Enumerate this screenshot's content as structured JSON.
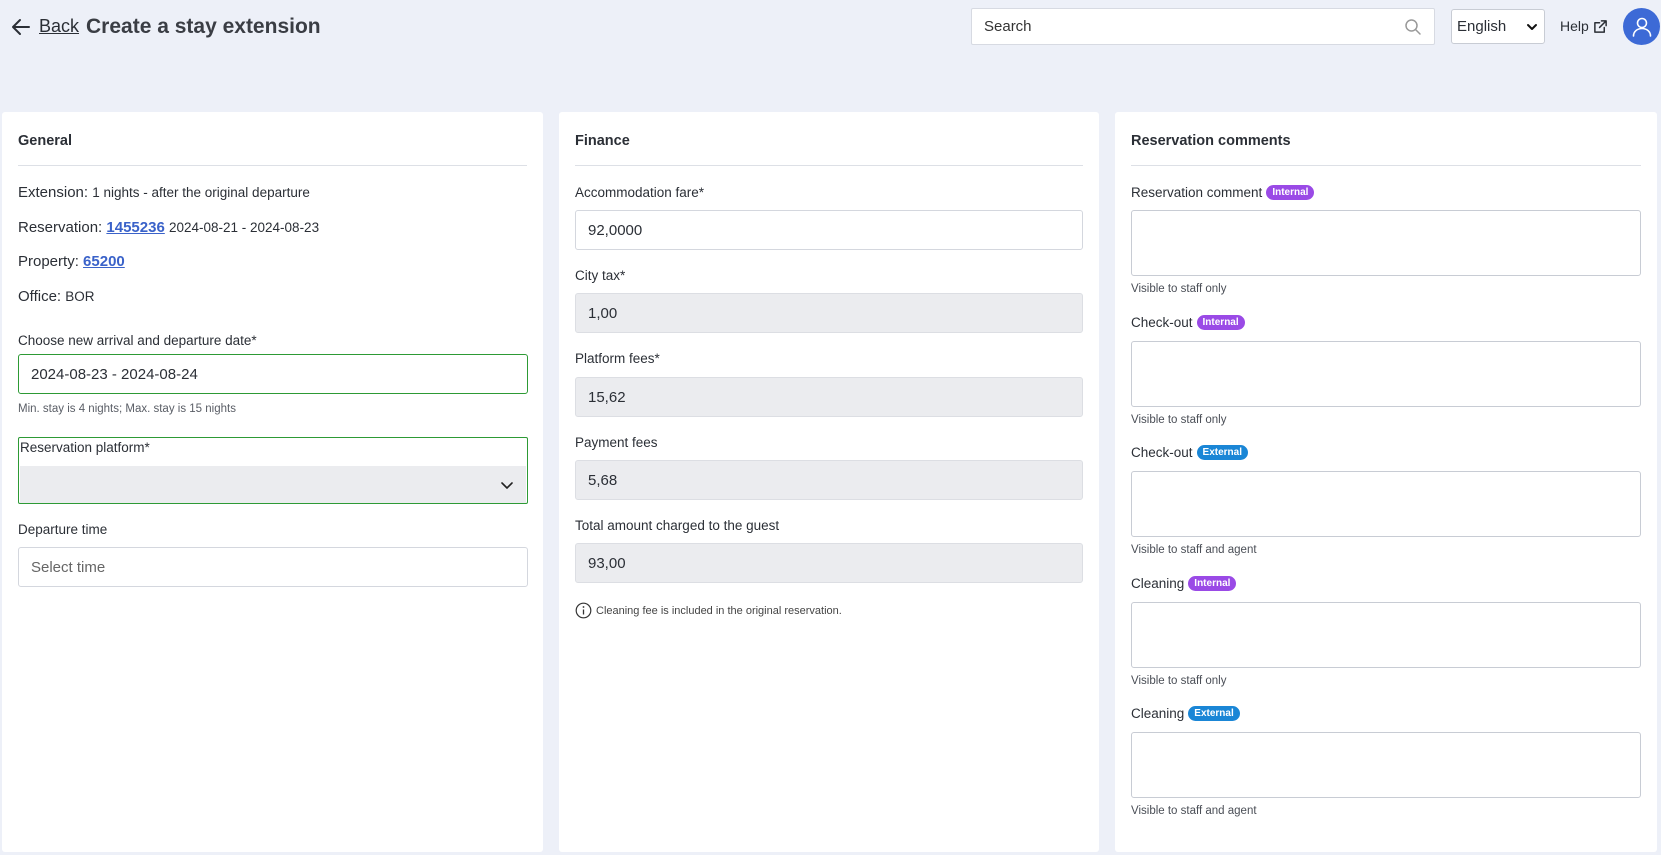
{
  "header": {
    "back_label": "Back",
    "title": "Create a stay extension",
    "search_placeholder": "Search",
    "language": "English",
    "help_label": "Help"
  },
  "general": {
    "title": "General",
    "extension_label": "Extension",
    "extension_value": "1 nights - after the original departure",
    "reservation_label": "Reservation",
    "reservation_id": "1455236",
    "reservation_dates": "2024-08-21 - 2024-08-23",
    "property_label": "Property",
    "property_id": "65200",
    "office_label": "Office",
    "office_value": "BOR",
    "date_label": "Choose new arrival and departure date*",
    "date_value": "2024-08-23 - 2024-08-24",
    "date_hint": "Min. stay is 4 nights; Max. stay is 15 nights",
    "platform_label": "Reservation platform*",
    "platform_value": "",
    "departure_label": "Departure time",
    "departure_placeholder": "Select time"
  },
  "finance": {
    "title": "Finance",
    "fields": [
      {
        "label": "Accommodation fare*",
        "value": "92,0000"
      },
      {
        "label": "City tax*",
        "value": "1,00"
      },
      {
        "label": "Platform fees*",
        "value": "15,62"
      },
      {
        "label": "Payment fees",
        "value": "5,68"
      },
      {
        "label": "Total amount charged to the guest",
        "value": "93,00"
      }
    ],
    "note": "Cleaning fee is included in the original reservation."
  },
  "comments": {
    "title": "Reservation comments",
    "items": [
      {
        "label": "Reservation comment",
        "badge": "Internal",
        "hint": "Visible to staff only"
      },
      {
        "label": "Check-out",
        "badge": "Internal",
        "hint": "Visible to staff only"
      },
      {
        "label": "Check-out",
        "badge": "External",
        "hint": "Visible to staff and agent"
      },
      {
        "label": "Cleaning",
        "badge": "Internal",
        "hint": "Visible to staff only"
      },
      {
        "label": "Cleaning",
        "badge": "External",
        "hint": "Visible to staff and agent"
      }
    ]
  },
  "colors": {
    "background": "#edf0f8",
    "link": "#3a62c9",
    "valid_border": "#2d9a35",
    "badge_internal": "#9a4ae6",
    "badge_external": "#1a86d6",
    "avatar": "#3d6ad6"
  }
}
